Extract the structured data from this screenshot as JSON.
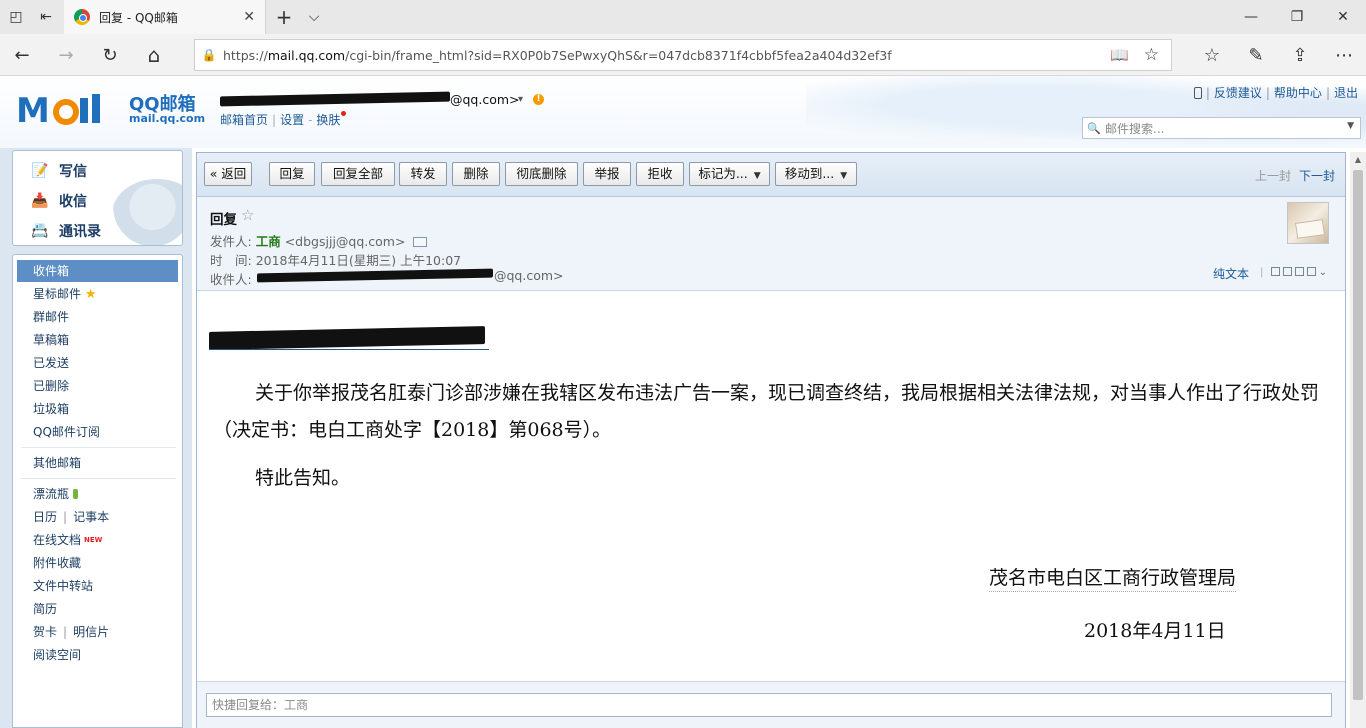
{
  "browser": {
    "tab_title": "回复 - QQ邮箱",
    "url_prefix": "https://",
    "url_host": "mail.qq.com",
    "url_path": "/cgi-bin/frame_html?sid=RX0P0b7SePwxyQhS&r=047dcb8371f4cbbf5fea2a404d32ef3f",
    "icons": {
      "tab_overview": "◰",
      "tab_set_aside": "⇤",
      "close": "✕",
      "new_tab": "+",
      "tab_list": "⌵",
      "minimize": "—",
      "restore": "❐",
      "win_close": "✕",
      "back": "←",
      "forward": "→",
      "refresh": "↻",
      "home": "⌂",
      "lock": "🔒",
      "reading": "📖",
      "favorite": "☆",
      "favorites_hub": "☆",
      "pen": "✎",
      "share": "⇪",
      "more": "⋯"
    }
  },
  "header": {
    "brand_name": "QQ邮箱",
    "brand_domain": "mail.qq.com",
    "account_suffix": "@qq.com>",
    "account_caret": "▾",
    "warn": "!",
    "links": {
      "home": "邮箱首页",
      "settings": "设置",
      "skin": "换肤"
    },
    "toplinks": {
      "feedback": "反馈建议",
      "help": "帮助中心",
      "logout": "退出"
    },
    "search_placeholder": "邮件搜索...",
    "search_icon": "🔍",
    "search_dropdown": "▼"
  },
  "quick": [
    {
      "label": "写信",
      "icon": "📝"
    },
    {
      "label": "收信",
      "icon": "📥"
    },
    {
      "label": "通讯录",
      "icon": "📇"
    }
  ],
  "folders": {
    "inbox": "收件箱",
    "starred": "星标邮件",
    "group": "群邮件",
    "drafts": "草稿箱",
    "sent": "已发送",
    "deleted": "已删除",
    "spam": "垃圾箱",
    "subscription": "QQ邮件订阅",
    "other": "其他邮箱",
    "bottle": "漂流瓶",
    "calendar": "日历",
    "notes": "记事本",
    "docs": "在线文档",
    "docs_badge": "NEW",
    "attachments": "附件收藏",
    "transfer": "文件中转站",
    "resume": "简历",
    "card": "贺卡",
    "postcard": "明信片",
    "reading": "阅读空间"
  },
  "toolbar": {
    "back": "« 返回",
    "reply": "回复",
    "reply_all": "回复全部",
    "forward": "转发",
    "delete": "删除",
    "delete_permanent": "彻底删除",
    "report": "举报",
    "reject": "拒收",
    "mark_as": "标记为...",
    "move_to": "移动到...",
    "dropdown_arrow": "▼",
    "prev": "上一封",
    "next": "下一封"
  },
  "mail": {
    "subject": "回复",
    "star": "☆",
    "from_label": "发件人:",
    "from_name": "工商",
    "from_addr": "<dbgsjjj@qq.com>",
    "time_label": "时　间:",
    "time_value": "2018年4月11日(星期三) 上午10:07",
    "to_label": "收件人:",
    "to_suffix": "@qq.com>",
    "plaintext": "纯文本",
    "body_p1": "关于你举报茂名肛泰门诊部涉嫌在我辖区发布违法广告一案，现已调查终结，我局根据相关法律法规，对当事人作出了行政处罚（决定书：电白工商处字【2018】第068号）。",
    "body_p2": "特此告知。",
    "signature_org": "茂名市电白区工商行政管理局",
    "signature_date": "2018年4月11日",
    "quick_reply": "快捷回复给：工商"
  },
  "colors": {
    "brand_blue": "#1f6fbd",
    "link": "#1d5a97",
    "sender_green": "#267a1c",
    "active_folder": "#5d8fc6",
    "logo_orange": "#f08a00"
  }
}
